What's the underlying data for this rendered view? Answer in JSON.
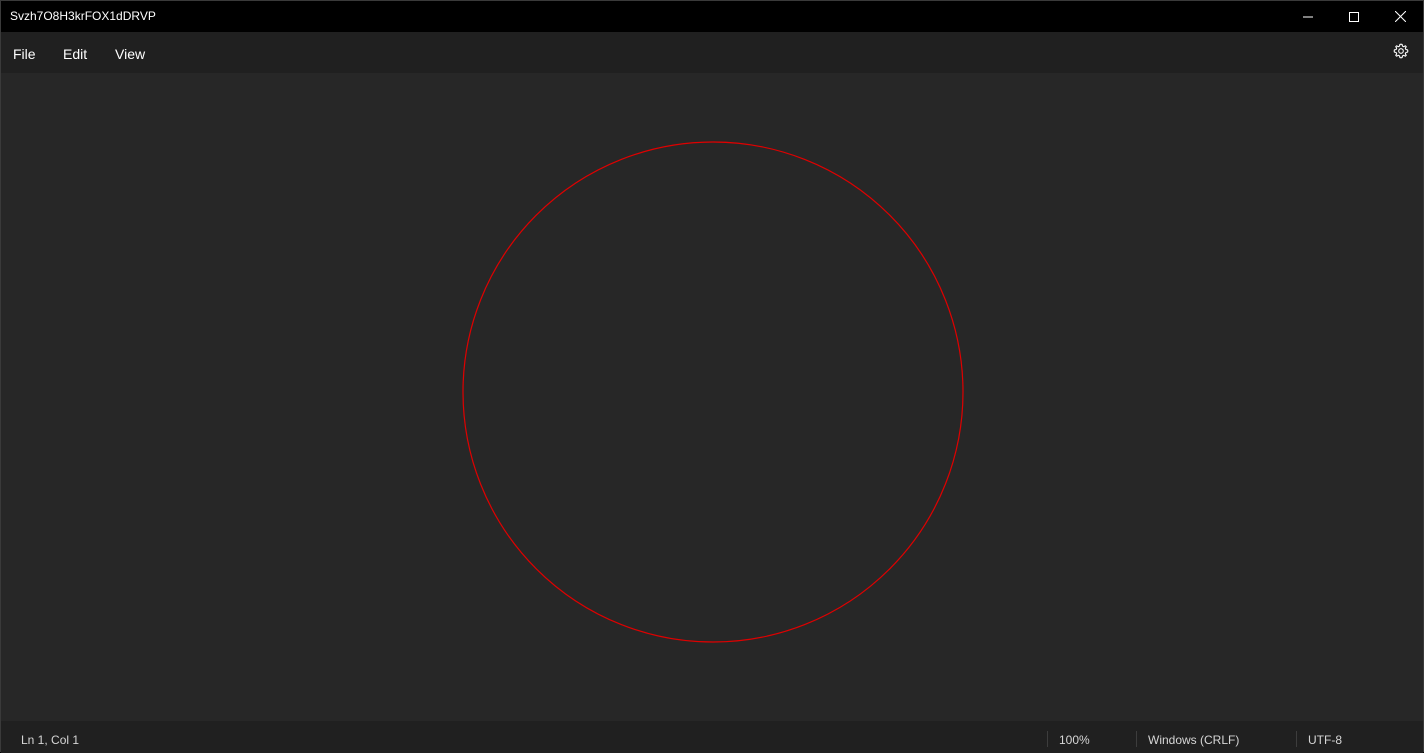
{
  "window": {
    "title": "Svzh7O8H3krFOX1dDRVP"
  },
  "caption": {
    "minimize_icon": "minimize-icon",
    "maximize_icon": "maximize-icon",
    "close_icon": "close-icon"
  },
  "menu": {
    "items": [
      "File",
      "Edit",
      "View"
    ],
    "settings_icon": "gear-icon"
  },
  "editor": {
    "content_text": "",
    "drawing": {
      "shape": "circle",
      "stroke_color": "#e00000"
    }
  },
  "status": {
    "position": "Ln 1, Col 1",
    "zoom": "100%",
    "line_ending": "Windows (CRLF)",
    "encoding": "UTF-8"
  },
  "colors": {
    "titlebar_bg": "#000000",
    "menubar_bg": "#202020",
    "editor_bg": "#272727",
    "statusbar_bg": "#202020",
    "text": "#ffffff"
  }
}
